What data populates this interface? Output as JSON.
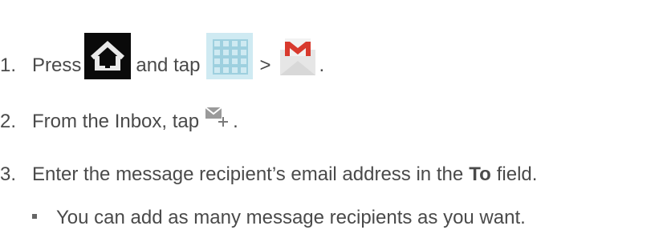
{
  "steps": [
    {
      "number": "1.",
      "text_a": "Press",
      "text_b": "and tap",
      "text_c": ">",
      "text_d": "."
    },
    {
      "number": "2.",
      "text_a": "From the Inbox, tap",
      "text_b": "."
    },
    {
      "number": "3.",
      "text_a": "Enter the message recipient’s email address in the",
      "bold": "To",
      "text_b": "field."
    }
  ],
  "bullets": [
    {
      "text": "You can add as many message recipients as you want."
    }
  ],
  "icons": {
    "home": "home-icon",
    "apps": "apps-icon",
    "gmail": "gmail-icon",
    "compose": "compose-mail-icon"
  },
  "colors": {
    "text": "#4a4a4a",
    "home_bg": "#0a0a0a",
    "apps_bg": "#cfeaf2",
    "gmail_red": "#d83a2e"
  }
}
